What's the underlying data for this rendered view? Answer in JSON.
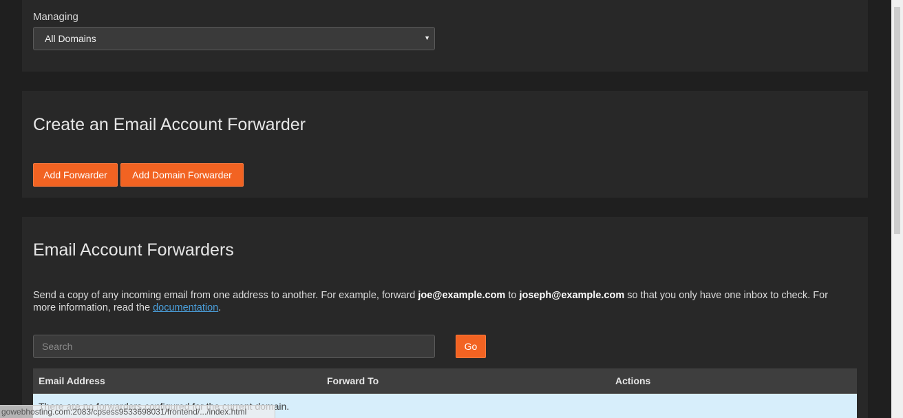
{
  "managing": {
    "label": "Managing",
    "selected": "All Domains"
  },
  "create": {
    "heading": "Create an Email Account Forwarder",
    "add_forwarder_label": "Add Forwarder",
    "add_domain_forwarder_label": "Add Domain Forwarder"
  },
  "list": {
    "heading": "Email Account Forwarders",
    "description": {
      "part1": "Send a copy of any incoming email from one address to another. For example, forward ",
      "example_from": "joe@example.com",
      "part2": " to ",
      "example_to": "joseph@example.com",
      "part3": " so that you only have one inbox to check. For more information, read the ",
      "link_text": "documentation",
      "part4": "."
    },
    "search": {
      "placeholder": "Search",
      "value": "",
      "go_label": "Go"
    },
    "table": {
      "columns": [
        "Email Address",
        "Forward To",
        "Actions"
      ],
      "empty_message": "There are no forwarders configured for the current domain."
    }
  },
  "status_bar": {
    "url": "gowebhosting.com:2083/cpsess9533698031/frontend/.../index.html"
  },
  "colors": {
    "accent": "#f26322",
    "page_bg": "#1f1f1f",
    "panel_bg": "#282828",
    "link": "#4a9eda",
    "empty_row_bg": "#d7eefb"
  }
}
